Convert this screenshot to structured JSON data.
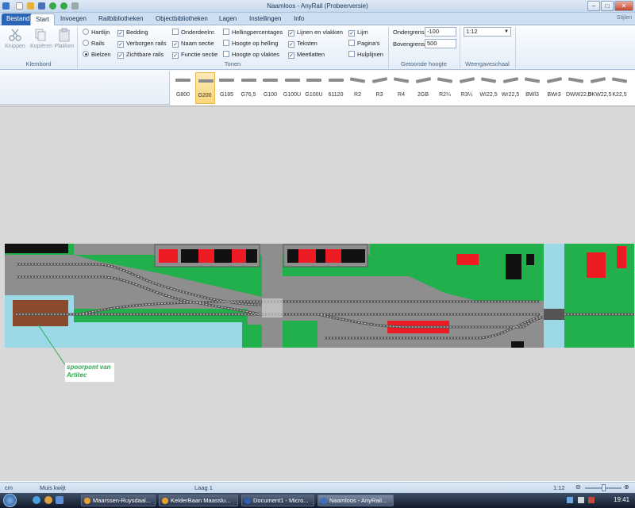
{
  "window": {
    "title": "Naamloos - AnyRail (Probeerversie)",
    "corner_label": "Stijlen"
  },
  "tabs": [
    "Bestand",
    "Start",
    "Invoegen",
    "Railbibliotheken",
    "Objectbibliotheken",
    "Lagen",
    "Instellingen",
    "Info"
  ],
  "active_tab": "Start",
  "ribbon": {
    "klembord": {
      "label": "Klembord",
      "buttons": [
        "Knippen",
        "Kopiëren",
        "Plakken"
      ]
    },
    "weergave_options": [
      {
        "label": "Hartlijn",
        "type": "radio",
        "checked": false
      },
      {
        "label": "Rails",
        "type": "radio",
        "checked": false
      },
      {
        "label": "Bielzen",
        "type": "radio",
        "checked": true
      }
    ],
    "bedding_options": [
      {
        "label": "Bedding",
        "checked": true
      },
      {
        "label": "Verborgen rails",
        "checked": true
      },
      {
        "label": "Zichtbare rails",
        "checked": true
      }
    ],
    "sectie_options": [
      {
        "label": "Onderdeelnr.",
        "checked": false
      },
      {
        "label": "Naam sectie",
        "checked": true
      },
      {
        "label": "Functie sectie",
        "checked": true
      }
    ],
    "helling_options": [
      {
        "label": "Hellingpercentages",
        "checked": false
      },
      {
        "label": "Hoogte op helling",
        "checked": false
      },
      {
        "label": "Hoogte op vlaktes",
        "checked": false
      }
    ],
    "lijnen_options": [
      {
        "label": "Lijnen en vlakken",
        "checked": true
      },
      {
        "label": "Teksten",
        "checked": true
      },
      {
        "label": "Meetlatten",
        "checked": true
      }
    ],
    "lijm_options": [
      {
        "label": "Lijm",
        "checked": true
      },
      {
        "label": "Pagina's",
        "checked": false
      },
      {
        "label": "Hulplijnen",
        "checked": false
      }
    ],
    "tonen_label": "Tonen",
    "hoogte": {
      "label": "Getoonde hoogte",
      "ondergrens_label": "Ondergrens",
      "ondergrens_value": "-100",
      "bovengrens_label": "Bovengrens",
      "bovengrens_value": "500"
    },
    "schaal": {
      "label": "Weergaveschaal",
      "value": "1:12"
    }
  },
  "track_pieces": [
    "G800",
    "G200",
    "G185",
    "G76,5",
    "G100",
    "G100U",
    "G100U",
    "61120",
    "R2",
    "R3",
    "R4",
    "2GB",
    "R2¼",
    "R3¼",
    "WI22,5",
    "Wr22,5",
    "BWl3",
    "BWr3",
    "DWW22,5",
    "DKW22,5",
    "K22,5"
  ],
  "selected_track": "G200",
  "canvas": {
    "annotation_line1": "spoorpont van",
    "annotation_line2": "Artitec"
  },
  "statusbar": {
    "unit": "cm",
    "mode": "Muis kwijt",
    "layer": "Laag 1",
    "scale": "1:12"
  },
  "taskbar": {
    "tasks": [
      "Maarssen-Ruysdaal...",
      "KelderBaan Maasslu...",
      "Document1 - Micro...",
      "Naamloos - AnyRail..."
    ],
    "clock": "19:41"
  },
  "colors": {
    "grass": "#22b04c",
    "water": "#9cd9e6",
    "road": "#8e8e8e",
    "platform": "#ed1c24",
    "brown": "#8b4a2b"
  }
}
